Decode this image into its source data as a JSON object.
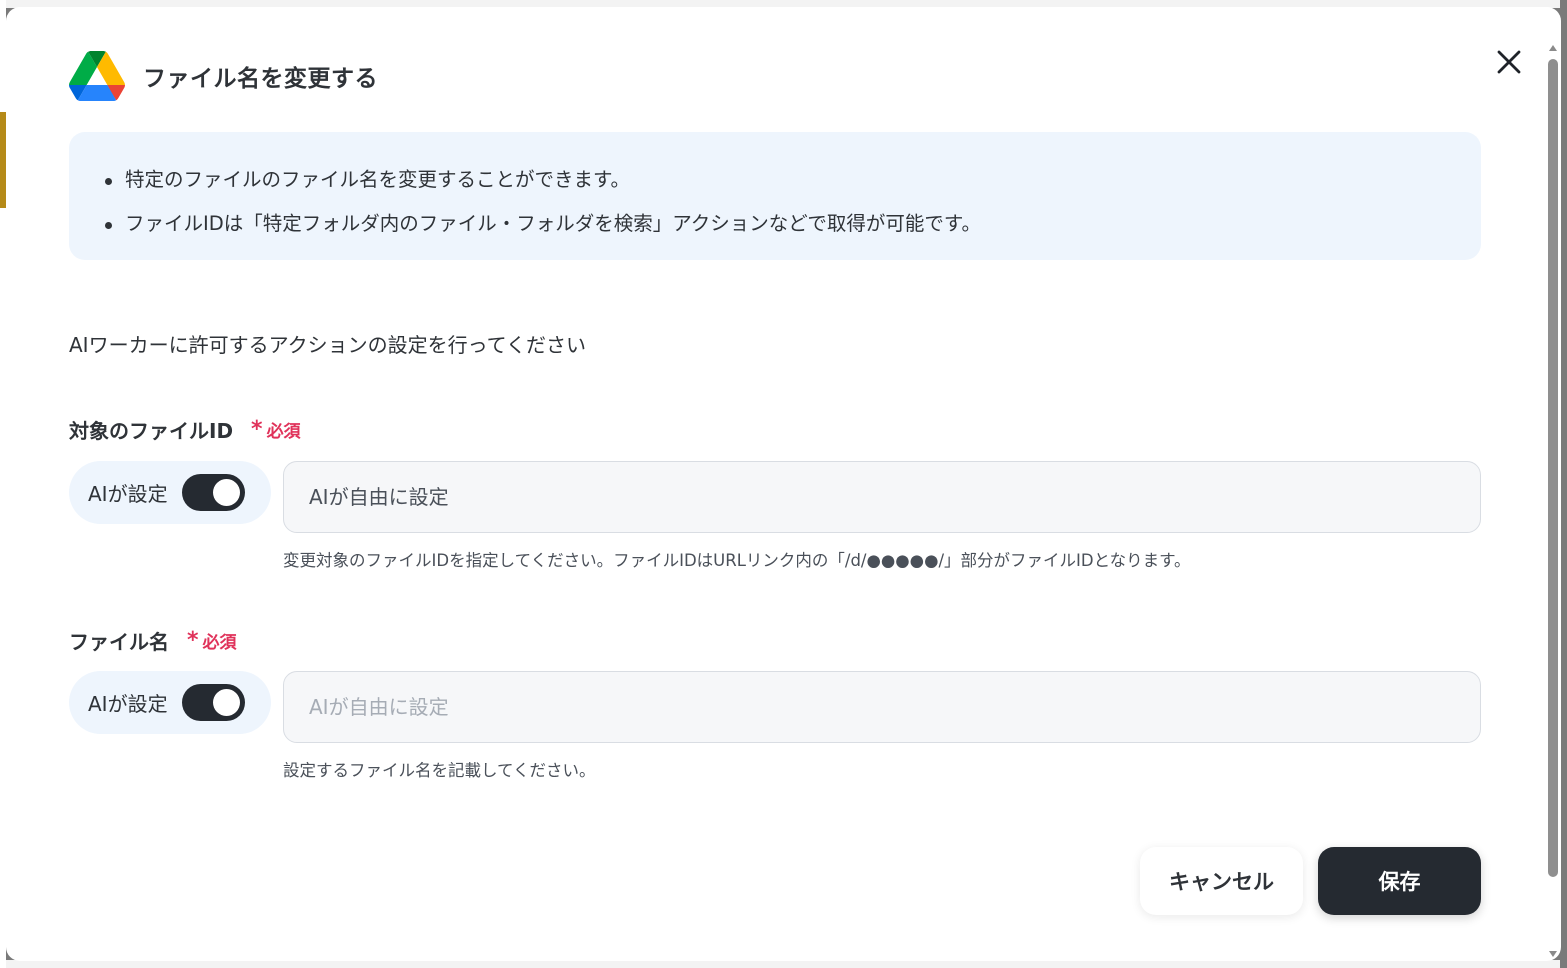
{
  "dialog": {
    "title": "ファイル名を変更する",
    "logo_icon": "google-drive-icon",
    "close_icon": "close-icon"
  },
  "info": {
    "bullets": [
      "特定のファイルのファイル名を変更することができます。",
      "ファイルIDは「特定フォルダ内のファイル・フォルダを検索」アクションなどで取得が可能です。"
    ]
  },
  "instruction": "AIワーカーに許可するアクションの設定を行ってください",
  "fields": [
    {
      "label": "対象のファイルID",
      "required_label": "必須",
      "ai_toggle_label": "AIが設定",
      "ai_toggle_on": true,
      "placeholder": "AIが自由に設定",
      "value": "",
      "help": "変更対象のファイルIDを指定してください。ファイルIDはURLリンク内の「/d/●●●●●/」部分がファイルIDとなります。"
    },
    {
      "label": "ファイル名",
      "required_label": "必須",
      "ai_toggle_label": "AIが設定",
      "ai_toggle_on": true,
      "placeholder": "AIが自由に設定",
      "value": "",
      "help": "設定するファイル名を記載してください。"
    }
  ],
  "buttons": {
    "cancel": "キャンセル",
    "save": "保存"
  },
  "colors": {
    "accent_dark": "#252a31",
    "required_red": "#e0325a",
    "info_bg": "#eef5fd"
  }
}
